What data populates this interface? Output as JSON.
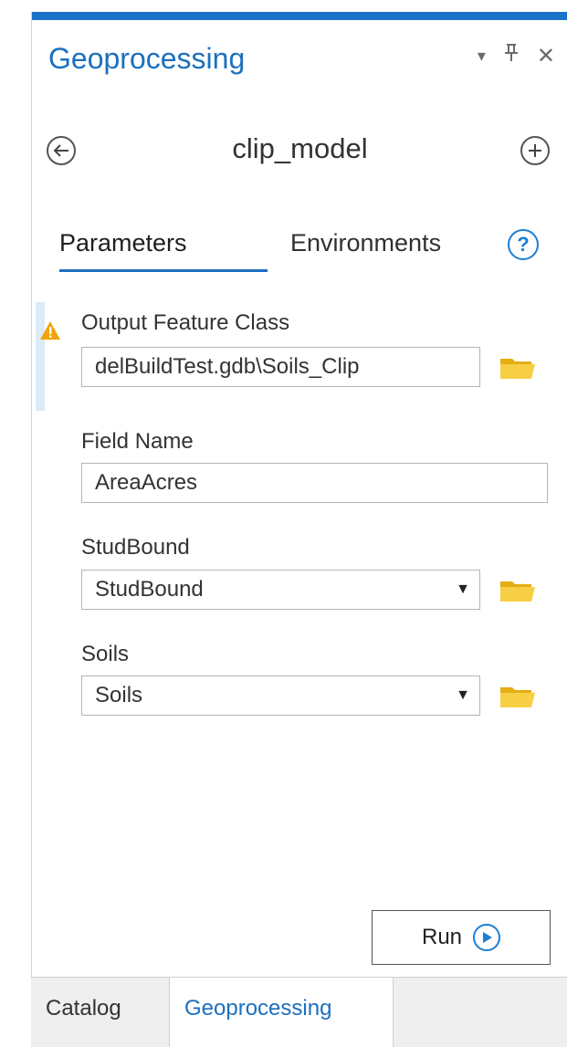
{
  "pane": {
    "title": "Geoprocessing",
    "controls": {
      "options": "▾",
      "pin": "⊥",
      "close": "✕"
    }
  },
  "nav": {
    "back_icon": "back-arrow-icon",
    "model_name": "clip_model",
    "add_icon": "plus-icon"
  },
  "tabs": {
    "parameters": "Parameters",
    "environments": "Environments"
  },
  "params": {
    "output_feature_class": {
      "label": "Output Feature Class",
      "value": "delBuildTest.gdb\\Soils_Clip",
      "status": "warning"
    },
    "field_name": {
      "label": "Field Name",
      "value": "AreaAcres"
    },
    "studbound": {
      "label": "StudBound",
      "value": "StudBound"
    },
    "soils": {
      "label": "Soils",
      "value": "Soils"
    }
  },
  "run": {
    "label": "Run"
  },
  "bottom_tabs": {
    "catalog": "Catalog",
    "geoprocessing": "Geoprocessing"
  },
  "colors": {
    "accent": "#1b70be",
    "warning": "#f0a30a",
    "folder": "#f2c230"
  }
}
